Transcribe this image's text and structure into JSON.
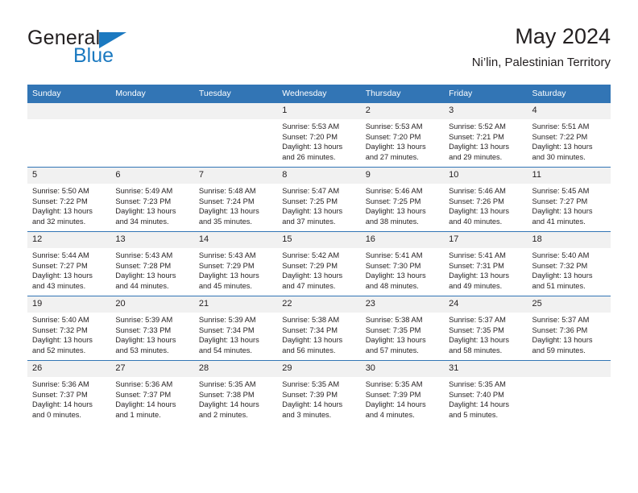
{
  "brand": {
    "name_part1": "General",
    "name_part2": "Blue",
    "triangle_icon": "triangle-icon"
  },
  "header": {
    "title": "May 2024",
    "subtitle": "Ni’lin, Palestinian Territory"
  },
  "colors": {
    "header_blue": "#3275b5",
    "brand_blue": "#1b79c0",
    "daynum_band": "#f1f1f1",
    "text": "#231f20"
  },
  "weekday_headers": [
    "Sunday",
    "Monday",
    "Tuesday",
    "Wednesday",
    "Thursday",
    "Friday",
    "Saturday"
  ],
  "labels": {
    "sunrise_prefix": "Sunrise:",
    "sunset_prefix": "Sunset:",
    "daylight_prefix": "Daylight:"
  },
  "weeks": [
    [
      {
        "day": "",
        "sunrise": "",
        "sunset": "",
        "daylight_line1": "",
        "daylight_line2": ""
      },
      {
        "day": "",
        "sunrise": "",
        "sunset": "",
        "daylight_line1": "",
        "daylight_line2": ""
      },
      {
        "day": "",
        "sunrise": "",
        "sunset": "",
        "daylight_line1": "",
        "daylight_line2": ""
      },
      {
        "day": "1",
        "sunrise": "Sunrise: 5:53 AM",
        "sunset": "Sunset: 7:20 PM",
        "daylight_line1": "Daylight: 13 hours",
        "daylight_line2": "and 26 minutes."
      },
      {
        "day": "2",
        "sunrise": "Sunrise: 5:53 AM",
        "sunset": "Sunset: 7:20 PM",
        "daylight_line1": "Daylight: 13 hours",
        "daylight_line2": "and 27 minutes."
      },
      {
        "day": "3",
        "sunrise": "Sunrise: 5:52 AM",
        "sunset": "Sunset: 7:21 PM",
        "daylight_line1": "Daylight: 13 hours",
        "daylight_line2": "and 29 minutes."
      },
      {
        "day": "4",
        "sunrise": "Sunrise: 5:51 AM",
        "sunset": "Sunset: 7:22 PM",
        "daylight_line1": "Daylight: 13 hours",
        "daylight_line2": "and 30 minutes."
      }
    ],
    [
      {
        "day": "5",
        "sunrise": "Sunrise: 5:50 AM",
        "sunset": "Sunset: 7:22 PM",
        "daylight_line1": "Daylight: 13 hours",
        "daylight_line2": "and 32 minutes."
      },
      {
        "day": "6",
        "sunrise": "Sunrise: 5:49 AM",
        "sunset": "Sunset: 7:23 PM",
        "daylight_line1": "Daylight: 13 hours",
        "daylight_line2": "and 34 minutes."
      },
      {
        "day": "7",
        "sunrise": "Sunrise: 5:48 AM",
        "sunset": "Sunset: 7:24 PM",
        "daylight_line1": "Daylight: 13 hours",
        "daylight_line2": "and 35 minutes."
      },
      {
        "day": "8",
        "sunrise": "Sunrise: 5:47 AM",
        "sunset": "Sunset: 7:25 PM",
        "daylight_line1": "Daylight: 13 hours",
        "daylight_line2": "and 37 minutes."
      },
      {
        "day": "9",
        "sunrise": "Sunrise: 5:46 AM",
        "sunset": "Sunset: 7:25 PM",
        "daylight_line1": "Daylight: 13 hours",
        "daylight_line2": "and 38 minutes."
      },
      {
        "day": "10",
        "sunrise": "Sunrise: 5:46 AM",
        "sunset": "Sunset: 7:26 PM",
        "daylight_line1": "Daylight: 13 hours",
        "daylight_line2": "and 40 minutes."
      },
      {
        "day": "11",
        "sunrise": "Sunrise: 5:45 AM",
        "sunset": "Sunset: 7:27 PM",
        "daylight_line1": "Daylight: 13 hours",
        "daylight_line2": "and 41 minutes."
      }
    ],
    [
      {
        "day": "12",
        "sunrise": "Sunrise: 5:44 AM",
        "sunset": "Sunset: 7:27 PM",
        "daylight_line1": "Daylight: 13 hours",
        "daylight_line2": "and 43 minutes."
      },
      {
        "day": "13",
        "sunrise": "Sunrise: 5:43 AM",
        "sunset": "Sunset: 7:28 PM",
        "daylight_line1": "Daylight: 13 hours",
        "daylight_line2": "and 44 minutes."
      },
      {
        "day": "14",
        "sunrise": "Sunrise: 5:43 AM",
        "sunset": "Sunset: 7:29 PM",
        "daylight_line1": "Daylight: 13 hours",
        "daylight_line2": "and 45 minutes."
      },
      {
        "day": "15",
        "sunrise": "Sunrise: 5:42 AM",
        "sunset": "Sunset: 7:29 PM",
        "daylight_line1": "Daylight: 13 hours",
        "daylight_line2": "and 47 minutes."
      },
      {
        "day": "16",
        "sunrise": "Sunrise: 5:41 AM",
        "sunset": "Sunset: 7:30 PM",
        "daylight_line1": "Daylight: 13 hours",
        "daylight_line2": "and 48 minutes."
      },
      {
        "day": "17",
        "sunrise": "Sunrise: 5:41 AM",
        "sunset": "Sunset: 7:31 PM",
        "daylight_line1": "Daylight: 13 hours",
        "daylight_line2": "and 49 minutes."
      },
      {
        "day": "18",
        "sunrise": "Sunrise: 5:40 AM",
        "sunset": "Sunset: 7:32 PM",
        "daylight_line1": "Daylight: 13 hours",
        "daylight_line2": "and 51 minutes."
      }
    ],
    [
      {
        "day": "19",
        "sunrise": "Sunrise: 5:40 AM",
        "sunset": "Sunset: 7:32 PM",
        "daylight_line1": "Daylight: 13 hours",
        "daylight_line2": "and 52 minutes."
      },
      {
        "day": "20",
        "sunrise": "Sunrise: 5:39 AM",
        "sunset": "Sunset: 7:33 PM",
        "daylight_line1": "Daylight: 13 hours",
        "daylight_line2": "and 53 minutes."
      },
      {
        "day": "21",
        "sunrise": "Sunrise: 5:39 AM",
        "sunset": "Sunset: 7:34 PM",
        "daylight_line1": "Daylight: 13 hours",
        "daylight_line2": "and 54 minutes."
      },
      {
        "day": "22",
        "sunrise": "Sunrise: 5:38 AM",
        "sunset": "Sunset: 7:34 PM",
        "daylight_line1": "Daylight: 13 hours",
        "daylight_line2": "and 56 minutes."
      },
      {
        "day": "23",
        "sunrise": "Sunrise: 5:38 AM",
        "sunset": "Sunset: 7:35 PM",
        "daylight_line1": "Daylight: 13 hours",
        "daylight_line2": "and 57 minutes."
      },
      {
        "day": "24",
        "sunrise": "Sunrise: 5:37 AM",
        "sunset": "Sunset: 7:35 PM",
        "daylight_line1": "Daylight: 13 hours",
        "daylight_line2": "and 58 minutes."
      },
      {
        "day": "25",
        "sunrise": "Sunrise: 5:37 AM",
        "sunset": "Sunset: 7:36 PM",
        "daylight_line1": "Daylight: 13 hours",
        "daylight_line2": "and 59 minutes."
      }
    ],
    [
      {
        "day": "26",
        "sunrise": "Sunrise: 5:36 AM",
        "sunset": "Sunset: 7:37 PM",
        "daylight_line1": "Daylight: 14 hours",
        "daylight_line2": "and 0 minutes."
      },
      {
        "day": "27",
        "sunrise": "Sunrise: 5:36 AM",
        "sunset": "Sunset: 7:37 PM",
        "daylight_line1": "Daylight: 14 hours",
        "daylight_line2": "and 1 minute."
      },
      {
        "day": "28",
        "sunrise": "Sunrise: 5:35 AM",
        "sunset": "Sunset: 7:38 PM",
        "daylight_line1": "Daylight: 14 hours",
        "daylight_line2": "and 2 minutes."
      },
      {
        "day": "29",
        "sunrise": "Sunrise: 5:35 AM",
        "sunset": "Sunset: 7:39 PM",
        "daylight_line1": "Daylight: 14 hours",
        "daylight_line2": "and 3 minutes."
      },
      {
        "day": "30",
        "sunrise": "Sunrise: 5:35 AM",
        "sunset": "Sunset: 7:39 PM",
        "daylight_line1": "Daylight: 14 hours",
        "daylight_line2": "and 4 minutes."
      },
      {
        "day": "31",
        "sunrise": "Sunrise: 5:35 AM",
        "sunset": "Sunset: 7:40 PM",
        "daylight_line1": "Daylight: 14 hours",
        "daylight_line2": "and 5 minutes."
      },
      {
        "day": "",
        "sunrise": "",
        "sunset": "",
        "daylight_line1": "",
        "daylight_line2": ""
      }
    ]
  ]
}
